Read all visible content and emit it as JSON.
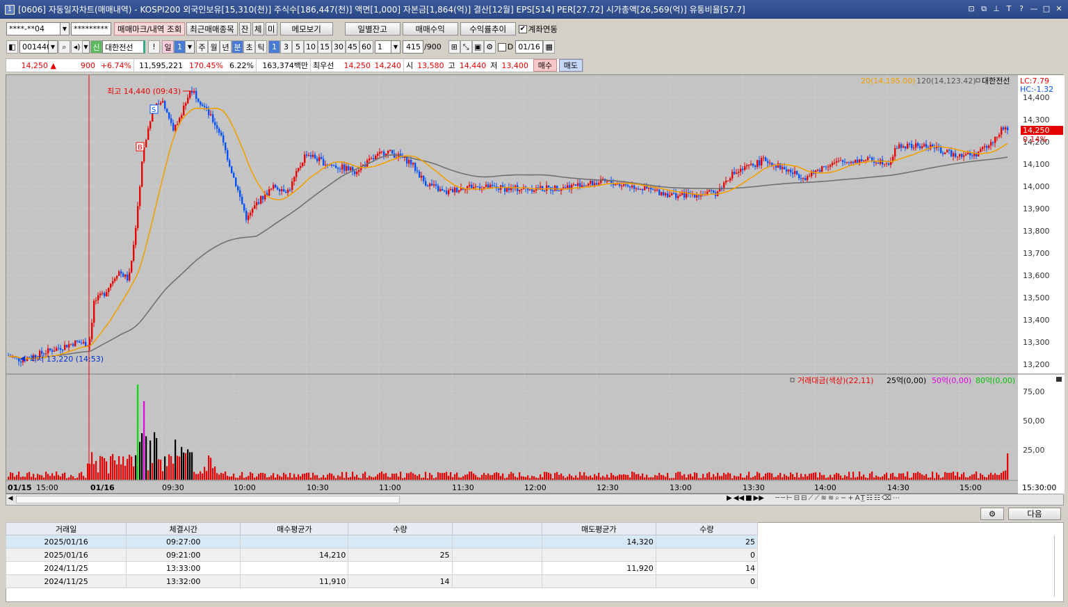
{
  "window": {
    "title": "[0606] 자동일자차트(매매내역) - KOSPI200 외국인보유[15,310(천)] 주식수[186,447(천)] 액면[1,000] 자본금[1,864(억)] 결산[12월] EPS[514] PER[27.72] 시가총액[26,569(억)] 유통비율[57.7]",
    "app_number": "1"
  },
  "toolbar1": {
    "account": "****-**04",
    "password": "*********",
    "btn_mark": "매매마크/내역 조회",
    "btn_recent": "최근매매종목",
    "btn_jan": "잔",
    "btn_che": "체",
    "btn_mi": "미",
    "btn_memo": "메모보기",
    "btn_daily": "일별잔고",
    "btn_profit": "매매수익",
    "btn_rate": "수익률추이",
    "chk_link": "계좌연동"
  },
  "toolbar2": {
    "code": "001440",
    "stock_name": "대한전선",
    "sin": "신",
    "excl": "!",
    "periods": [
      "일",
      "1",
      "주",
      "월",
      "년",
      "분",
      "초",
      "틱"
    ],
    "intervals": [
      "1",
      "3",
      "5",
      "10",
      "15",
      "30",
      "45",
      "60"
    ],
    "unit_value": "1",
    "count": "415",
    "count_total": "/900",
    "d_label": "D",
    "date": "01/16"
  },
  "quote": {
    "price": "14,250",
    "arrow": "▲",
    "change": "900",
    "change_pct": "+6.74%",
    "volume": "11,595,221",
    "vol_ratio": "170.45%",
    "turnover": "6.22%",
    "amount": "163,374백만",
    "best_label": "최우선",
    "best_ask": "14,250",
    "best_bid": "14,240",
    "open_label": "시",
    "open": "13,580",
    "high_label": "고",
    "high": "14,440",
    "low_label": "저",
    "low": "13,400",
    "buy": "매수",
    "sell": "매도"
  },
  "chart": {
    "legend_ma20": "20(14,195.00)",
    "legend_ma120": "120(14,123.42)",
    "legend_name": "대한전선",
    "lc": "LC:7.79",
    "hc": "HC:-1.32",
    "price_tag": "14,250",
    "pct_tag": "0.14%",
    "high_note": "최고 14,440 (09:43)",
    "low_note": "최저 13,220 (14:53)",
    "mark_s": "S",
    "mark_b": "B",
    "vol_legend_name": "거래대금(색상)(22,11)",
    "vol_legend_25": "25억(0,00)",
    "vol_legend_50": "50억(0,00)",
    "vol_legend_80": "80억(0,00)",
    "price_ticks": [
      "14,400",
      "14,300",
      "14,200",
      "14,100",
      "14,000",
      "13,900",
      "13,800",
      "13,700",
      "13,600",
      "13,500",
      "13,400",
      "13,300",
      "13,200"
    ],
    "vol_ticks": [
      "75,00",
      "50,00",
      "25,00"
    ],
    "time_ticks": [
      "01/15",
      "15:00",
      "01/16",
      "09:30",
      "10:00",
      "10:30",
      "11:00",
      "11:30",
      "12:00",
      "12:30",
      "13:00",
      "13:30",
      "14:00",
      "14:30",
      "15:00",
      "15:30:00"
    ],
    "colors": {
      "up": "#e60000",
      "down": "#0050ff",
      "ma20": "#f0a000",
      "ma120": "#707070",
      "vol": "#e60000"
    }
  },
  "chart_data": {
    "type": "candlestick",
    "title": "",
    "ylim": [
      13170,
      14450
    ],
    "high": 14440,
    "low": 13220,
    "close": 14250,
    "x_range": [
      "01/15 14:53",
      "01/16 15:30"
    ],
    "ma20_last": 14195.0,
    "ma120_last": 14123.42
  },
  "bottom_right": {
    "next": "다음"
  },
  "table": {
    "headers": [
      "거래일",
      "체결시간",
      "매수평균가",
      "수량",
      "",
      "매도평균가",
      "수량"
    ],
    "rows": [
      [
        "2025/01/16",
        "09:27:00",
        "",
        "",
        "",
        "14,320",
        "25"
      ],
      [
        "2025/01/16",
        "09:21:00",
        "14,210",
        "25",
        "",
        "",
        "0"
      ],
      [
        "2024/11/25",
        "13:33:00",
        "",
        "",
        "",
        "11,920",
        "14"
      ],
      [
        "2024/11/25",
        "13:32:00",
        "11,910",
        "14",
        "",
        "",
        "0"
      ]
    ]
  }
}
